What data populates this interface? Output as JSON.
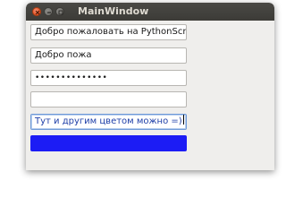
{
  "window": {
    "title": "MainWindow"
  },
  "fields": {
    "greeting_value": "Добро пожаловать на PythonScripts",
    "partial_value": "Добро пожа",
    "password_value": "••••••••••••••",
    "empty_value": "",
    "colored_value": "Тут и другим цветом можно =)"
  },
  "colors": {
    "titlebar": "#3c3b37",
    "close_button": "#e8572b",
    "window_bg": "#efeeec",
    "colored_text": "#1f3fa8",
    "blue_block": "#1c1cf5"
  },
  "icons": {
    "close": "close-icon",
    "minimize": "minimize-icon",
    "maximize": "maximize-icon"
  }
}
